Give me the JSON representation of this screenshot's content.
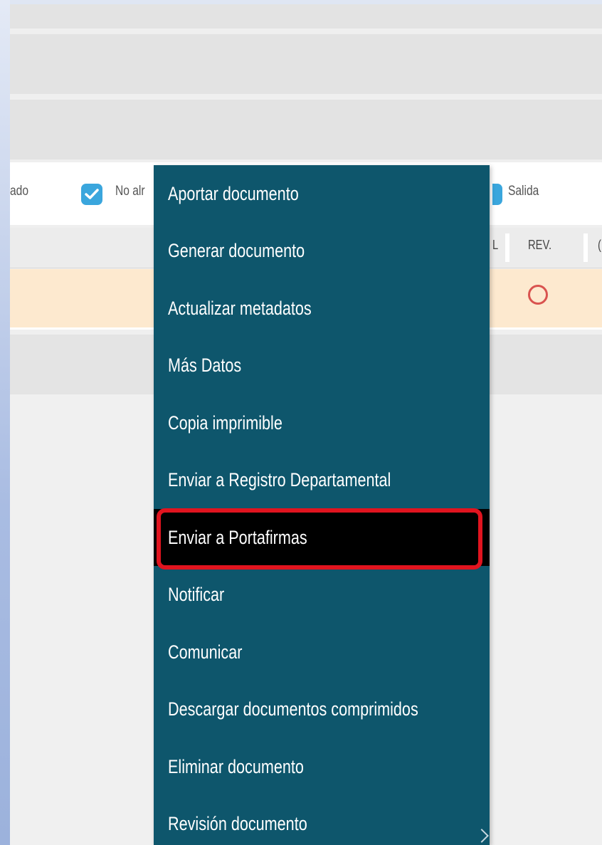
{
  "filters": {
    "cut_left_label": "ado",
    "no_alr_label": "No alr",
    "salida_label": "Salida"
  },
  "table": {
    "header_cut_label": "L",
    "header_rev_label": "REV.",
    "header_next_cut_label": "("
  },
  "context_menu": {
    "items": [
      {
        "label": "Aportar documento"
      },
      {
        "label": "Generar documento"
      },
      {
        "label": "Actualizar metadatos"
      },
      {
        "label": "Más Datos"
      },
      {
        "label": "Copia imprimible"
      },
      {
        "label": "Enviar a Registro Departamental"
      },
      {
        "label": "Enviar a Portafirmas"
      },
      {
        "label": "Notificar"
      },
      {
        "label": "Comunicar"
      },
      {
        "label": "Descargar documentos comprimidos"
      },
      {
        "label": "Eliminar documento"
      },
      {
        "label": "Revisión documento"
      }
    ],
    "highlighted_item": "Enviar a Portafirmas"
  },
  "colors": {
    "menu_background": "#0e566c",
    "highlight_border": "#e0141f",
    "checkbox": "#3aa6dd",
    "row_highlight": "#fde9cf",
    "rev_circle": "#d9534f"
  },
  "icons": {
    "checkbox": "check-icon",
    "rev_status": "circle-icon",
    "submenu": "chevron-right-icon"
  }
}
